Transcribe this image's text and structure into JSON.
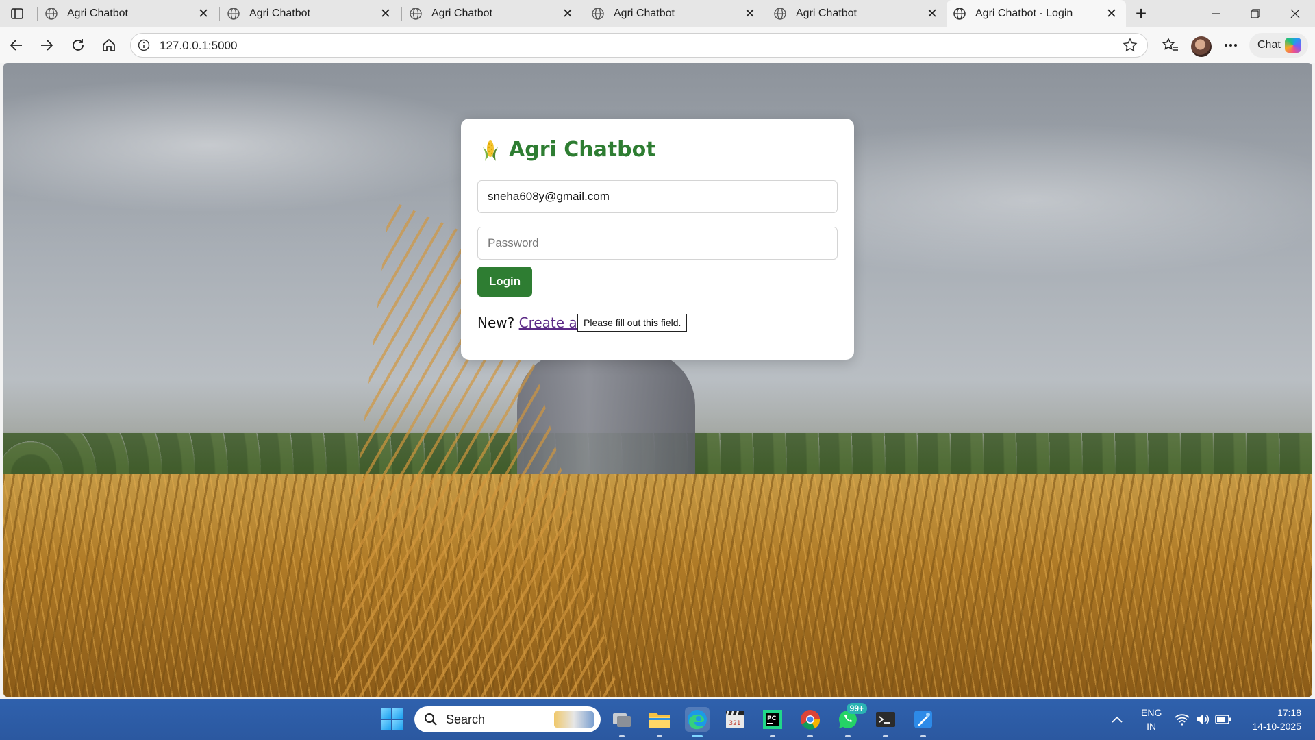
{
  "browser": {
    "tabs": [
      {
        "title": "Agri Chatbot",
        "active": false
      },
      {
        "title": "Agri Chatbot",
        "active": false
      },
      {
        "title": "Agri Chatbot",
        "active": false
      },
      {
        "title": "Agri Chatbot",
        "active": false
      },
      {
        "title": "Agri Chatbot",
        "active": false
      },
      {
        "title": "Agri Chatbot - Login",
        "active": true
      }
    ],
    "url": "127.0.0.1:5000",
    "chat_label": "Chat"
  },
  "login": {
    "app_title": "Agri Chatbot",
    "email_value": "sneha608y@gmail.com",
    "password_placeholder": "Password",
    "validation_tooltip": "Please fill out this field.",
    "login_label": "Login",
    "signup_prompt": "New?",
    "signup_link": "Create an account",
    "brand_color": "#2e7d32"
  },
  "taskbar": {
    "search_label": "Search",
    "whatsapp_badge": "99+",
    "lang_line1": "ENG",
    "lang_line2": "IN",
    "time": "17:18",
    "date": "14-10-2025",
    "accent": "#2f61ad"
  }
}
